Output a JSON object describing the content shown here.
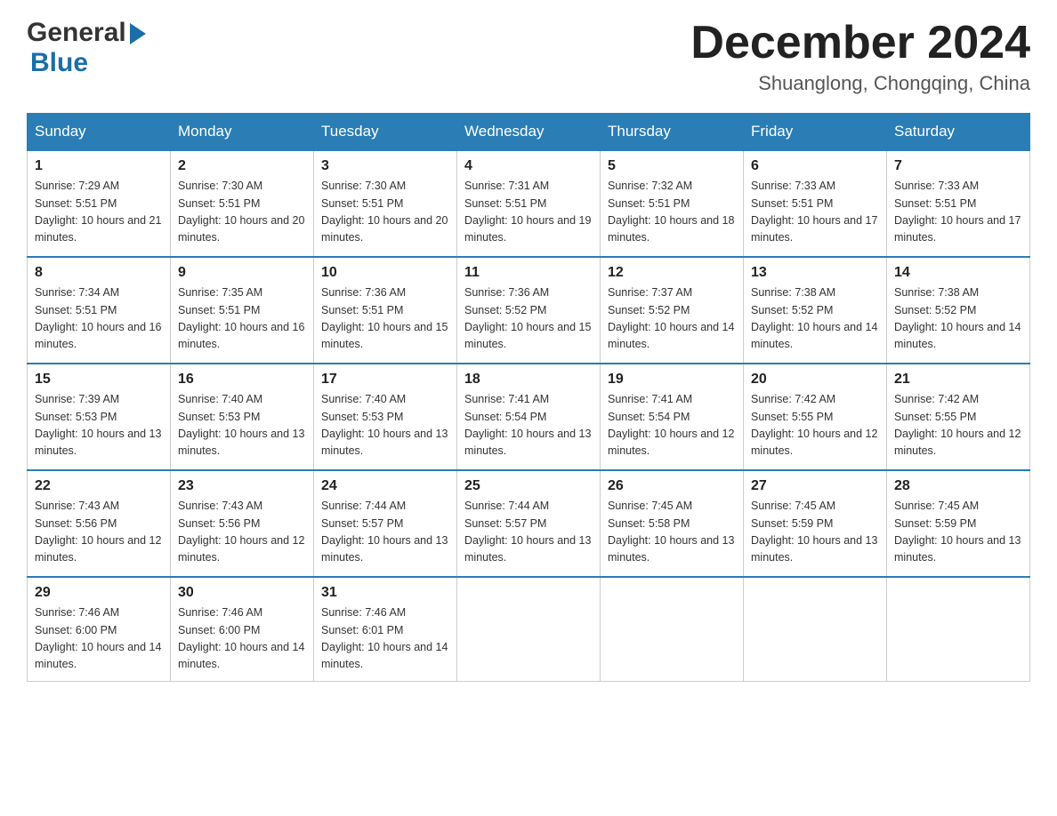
{
  "header": {
    "logo_general": "General",
    "logo_blue": "Blue",
    "month_title": "December 2024",
    "location": "Shuanglong, Chongqing, China"
  },
  "days_of_week": [
    "Sunday",
    "Monday",
    "Tuesday",
    "Wednesday",
    "Thursday",
    "Friday",
    "Saturday"
  ],
  "weeks": [
    [
      {
        "day": "1",
        "sunrise": "7:29 AM",
        "sunset": "5:51 PM",
        "daylight": "10 hours and 21 minutes."
      },
      {
        "day": "2",
        "sunrise": "7:30 AM",
        "sunset": "5:51 PM",
        "daylight": "10 hours and 20 minutes."
      },
      {
        "day": "3",
        "sunrise": "7:30 AM",
        "sunset": "5:51 PM",
        "daylight": "10 hours and 20 minutes."
      },
      {
        "day": "4",
        "sunrise": "7:31 AM",
        "sunset": "5:51 PM",
        "daylight": "10 hours and 19 minutes."
      },
      {
        "day": "5",
        "sunrise": "7:32 AM",
        "sunset": "5:51 PM",
        "daylight": "10 hours and 18 minutes."
      },
      {
        "day": "6",
        "sunrise": "7:33 AM",
        "sunset": "5:51 PM",
        "daylight": "10 hours and 17 minutes."
      },
      {
        "day": "7",
        "sunrise": "7:33 AM",
        "sunset": "5:51 PM",
        "daylight": "10 hours and 17 minutes."
      }
    ],
    [
      {
        "day": "8",
        "sunrise": "7:34 AM",
        "sunset": "5:51 PM",
        "daylight": "10 hours and 16 minutes."
      },
      {
        "day": "9",
        "sunrise": "7:35 AM",
        "sunset": "5:51 PM",
        "daylight": "10 hours and 16 minutes."
      },
      {
        "day": "10",
        "sunrise": "7:36 AM",
        "sunset": "5:51 PM",
        "daylight": "10 hours and 15 minutes."
      },
      {
        "day": "11",
        "sunrise": "7:36 AM",
        "sunset": "5:52 PM",
        "daylight": "10 hours and 15 minutes."
      },
      {
        "day": "12",
        "sunrise": "7:37 AM",
        "sunset": "5:52 PM",
        "daylight": "10 hours and 14 minutes."
      },
      {
        "day": "13",
        "sunrise": "7:38 AM",
        "sunset": "5:52 PM",
        "daylight": "10 hours and 14 minutes."
      },
      {
        "day": "14",
        "sunrise": "7:38 AM",
        "sunset": "5:52 PM",
        "daylight": "10 hours and 14 minutes."
      }
    ],
    [
      {
        "day": "15",
        "sunrise": "7:39 AM",
        "sunset": "5:53 PM",
        "daylight": "10 hours and 13 minutes."
      },
      {
        "day": "16",
        "sunrise": "7:40 AM",
        "sunset": "5:53 PM",
        "daylight": "10 hours and 13 minutes."
      },
      {
        "day": "17",
        "sunrise": "7:40 AM",
        "sunset": "5:53 PM",
        "daylight": "10 hours and 13 minutes."
      },
      {
        "day": "18",
        "sunrise": "7:41 AM",
        "sunset": "5:54 PM",
        "daylight": "10 hours and 13 minutes."
      },
      {
        "day": "19",
        "sunrise": "7:41 AM",
        "sunset": "5:54 PM",
        "daylight": "10 hours and 12 minutes."
      },
      {
        "day": "20",
        "sunrise": "7:42 AM",
        "sunset": "5:55 PM",
        "daylight": "10 hours and 12 minutes."
      },
      {
        "day": "21",
        "sunrise": "7:42 AM",
        "sunset": "5:55 PM",
        "daylight": "10 hours and 12 minutes."
      }
    ],
    [
      {
        "day": "22",
        "sunrise": "7:43 AM",
        "sunset": "5:56 PM",
        "daylight": "10 hours and 12 minutes."
      },
      {
        "day": "23",
        "sunrise": "7:43 AM",
        "sunset": "5:56 PM",
        "daylight": "10 hours and 12 minutes."
      },
      {
        "day": "24",
        "sunrise": "7:44 AM",
        "sunset": "5:57 PM",
        "daylight": "10 hours and 13 minutes."
      },
      {
        "day": "25",
        "sunrise": "7:44 AM",
        "sunset": "5:57 PM",
        "daylight": "10 hours and 13 minutes."
      },
      {
        "day": "26",
        "sunrise": "7:45 AM",
        "sunset": "5:58 PM",
        "daylight": "10 hours and 13 minutes."
      },
      {
        "day": "27",
        "sunrise": "7:45 AM",
        "sunset": "5:59 PM",
        "daylight": "10 hours and 13 minutes."
      },
      {
        "day": "28",
        "sunrise": "7:45 AM",
        "sunset": "5:59 PM",
        "daylight": "10 hours and 13 minutes."
      }
    ],
    [
      {
        "day": "29",
        "sunrise": "7:46 AM",
        "sunset": "6:00 PM",
        "daylight": "10 hours and 14 minutes."
      },
      {
        "day": "30",
        "sunrise": "7:46 AM",
        "sunset": "6:00 PM",
        "daylight": "10 hours and 14 minutes."
      },
      {
        "day": "31",
        "sunrise": "7:46 AM",
        "sunset": "6:01 PM",
        "daylight": "10 hours and 14 minutes."
      },
      {
        "day": "",
        "sunrise": "",
        "sunset": "",
        "daylight": ""
      },
      {
        "day": "",
        "sunrise": "",
        "sunset": "",
        "daylight": ""
      },
      {
        "day": "",
        "sunrise": "",
        "sunset": "",
        "daylight": ""
      },
      {
        "day": "",
        "sunrise": "",
        "sunset": "",
        "daylight": ""
      }
    ]
  ],
  "labels": {
    "sunrise_prefix": "Sunrise: ",
    "sunset_prefix": "Sunset: ",
    "daylight_prefix": "Daylight: "
  }
}
